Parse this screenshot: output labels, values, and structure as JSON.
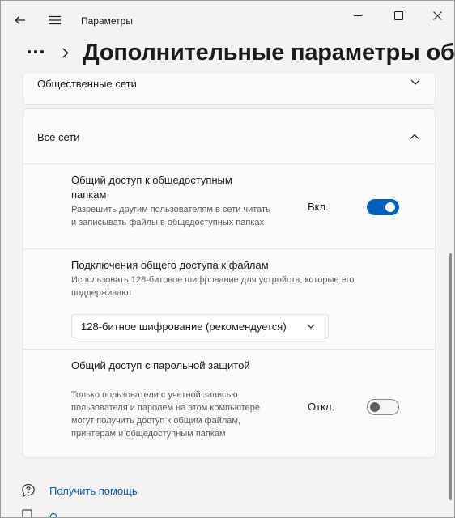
{
  "app": {
    "title": "Параметры"
  },
  "window_controls": {
    "minimize": "minimize-icon",
    "maximize": "maximize-icon",
    "close": "close-icon"
  },
  "breadcrumb": {
    "more": "...",
    "page_title": "Дополнительные параметры общего доступа"
  },
  "sections": {
    "public_networks": {
      "label": "Общественные сети"
    },
    "all_networks": {
      "label": "Все сети",
      "public_folder_sharing": {
        "title": "Общий доступ к общедоступным папкам",
        "description": "Разрешить другим пользователям в сети читать и записывать файлы в общедоступных папках",
        "state_label": "Вкл.",
        "enabled": true
      },
      "file_sharing_connections": {
        "title": "Подключения общего доступа к файлам",
        "description": "Использовать 128-битовое шифрование для устройств, которые его поддерживают",
        "selected_option": "128-битное шифрование (рекомендуется)"
      },
      "password_protected_sharing": {
        "title": "Общий доступ с парольной защитой",
        "description": "Только пользователи с учетной записью пользователя и паролем на этом компьютере могут получить доступ к общим файлам, принтерам и общедоступным папкам",
        "state_label": "Откл.",
        "enabled": false
      }
    }
  },
  "footer": {
    "help": "Получить помощь",
    "feedback": "О"
  },
  "colors": {
    "accent": "#005fb8",
    "link": "#0a5db8",
    "background": "#f3f3f3",
    "card": "#fbfbfb"
  }
}
